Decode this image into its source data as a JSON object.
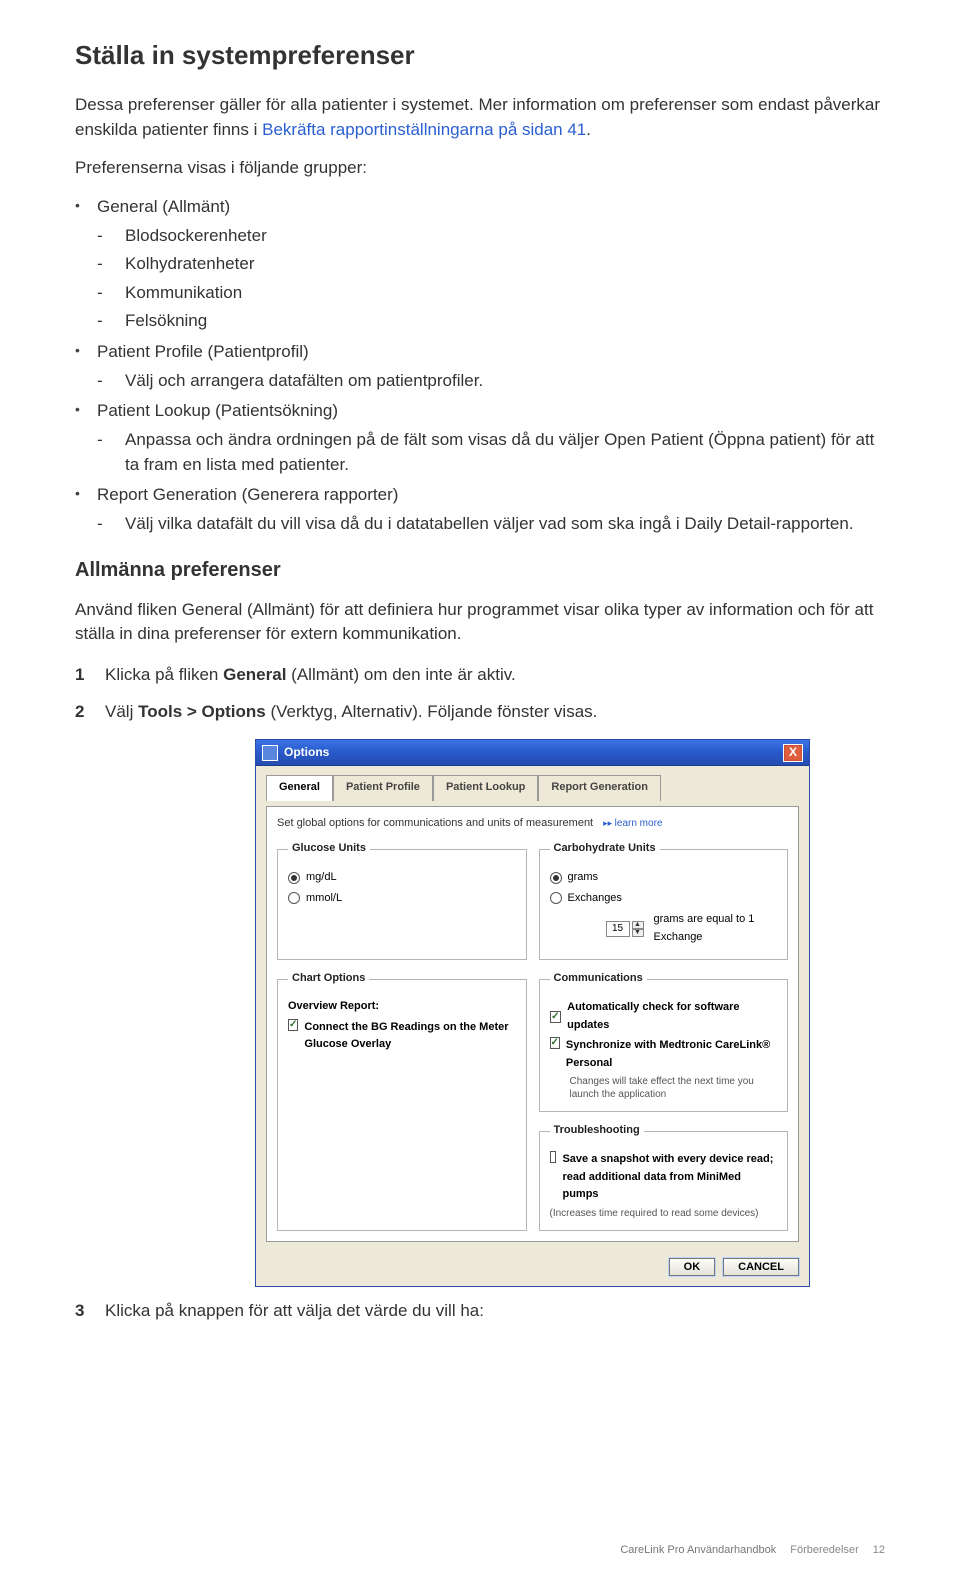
{
  "heading": "Ställa in systempreferenser",
  "intro_prefix": "Dessa preferenser gäller för alla patienter i systemet. Mer information om preferenser som endast påverkar enskilda patienter finns i ",
  "intro_link": "Bekräfta rapportinställningarna på sidan 41",
  "intro_suffix": ".",
  "groups_intro": "Preferenserna visas i följande grupper:",
  "bullets": {
    "general": {
      "label": "General (Allmänt)",
      "items": [
        "Blodsockerenheter",
        "Kolhydratenheter",
        "Kommunikation",
        "Felsökning"
      ]
    },
    "profile": {
      "label": "Patient Profile (Patientprofil)",
      "items": [
        "Välj och arrangera datafälten om patientprofiler."
      ]
    },
    "lookup": {
      "label": "Patient Lookup (Patientsökning)",
      "items": [
        "Anpassa och ändra ordningen på de fält som visas då du väljer Open Patient (Öppna patient) för att ta fram en lista med patienter."
      ]
    },
    "report": {
      "label": "Report Generation (Generera rapporter)",
      "items": [
        "Välj vilka datafält du vill visa då du i datatabellen väljer vad som ska ingå i Daily Detail-rapporten."
      ]
    }
  },
  "sub_heading": "Allmänna preferenser",
  "sub_para": "Använd fliken General (Allmänt) för att definiera hur programmet visar olika typer av information och för att ställa in dina preferenser för extern kommunikation.",
  "step1_a": "Klicka på fliken ",
  "step1_b": "General",
  "step1_c": " (Allmänt) om den inte är aktiv.",
  "step2_a": "Välj ",
  "step2_b": "Tools > Options",
  "step2_c": " (Verktyg, Alternativ). Följande fönster visas.",
  "step3": "Klicka på knappen för att välja det värde du vill ha:",
  "dialog": {
    "title": "Options",
    "close": "X",
    "tabs": [
      "General",
      "Patient Profile",
      "Patient Lookup",
      "Report Generation"
    ],
    "desc": "Set global options for communications and units of measurement",
    "learn_more": "learn more",
    "glucose": {
      "legend": "Glucose Units",
      "mgdl": "mg/dL",
      "mmol": "mmol/L"
    },
    "carb": {
      "legend": "Carbohydrate Units",
      "grams": "grams",
      "exch": "Exchanges",
      "spinner_value": "15",
      "spinner_label": "grams are equal to 1 Exchange"
    },
    "chart": {
      "legend": "Chart Options",
      "overview": "Overview Report:",
      "connect": "Connect the BG Readings on the Meter Glucose Overlay"
    },
    "comm": {
      "legend": "Communications",
      "auto": "Automatically check for software updates",
      "sync": "Synchronize with Medtronic CareLink® Personal",
      "sync_note": "Changes will take effect the next time you launch the application"
    },
    "ts": {
      "legend": "Troubleshooting",
      "save": "Save a snapshot with every device read; read additional data from MiniMed pumps",
      "note": "(Increases time required to read some devices)"
    },
    "ok": "OK",
    "cancel": "CANCEL"
  },
  "footer": {
    "product": "CareLink Pro Användarhandbok",
    "section": "Förberedelser",
    "page": "12"
  }
}
